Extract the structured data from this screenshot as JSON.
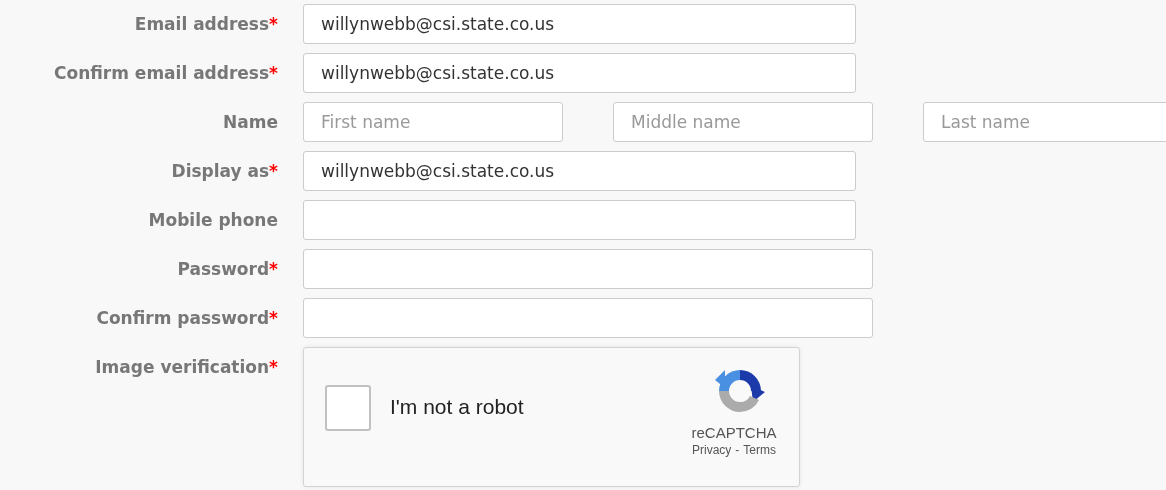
{
  "form": {
    "rows": [
      {
        "kind": "input",
        "label": "Email address",
        "required_mark": "*",
        "value": "willynwebb@csi.state.co.us"
      },
      {
        "kind": "input",
        "label": "Confirm email address",
        "required_mark": "*",
        "value": "willynwebb@csi.state.co.us"
      },
      {
        "kind": "name",
        "label": "Name",
        "parts": [
          {
            "placeholder": "First name"
          },
          {
            "placeholder": "Middle name"
          },
          {
            "placeholder": "Last name"
          }
        ]
      },
      {
        "kind": "input",
        "label": "Display as",
        "required_mark": "*",
        "value": "willynwebb@csi.state.co.us"
      },
      {
        "kind": "input",
        "label": "Mobile phone"
      },
      {
        "kind": "input",
        "label": "Password",
        "required_mark": "*"
      },
      {
        "kind": "input",
        "label": "Confirm password",
        "required_mark": "*"
      },
      {
        "kind": "captcha",
        "label": "Image verification",
        "required_mark": "*",
        "checkbox_label": "I'm not a robot",
        "checked": false,
        "brand": "reCAPTCHA",
        "privacy": "Privacy",
        "separator": "-",
        "terms": "Terms"
      }
    ]
  }
}
